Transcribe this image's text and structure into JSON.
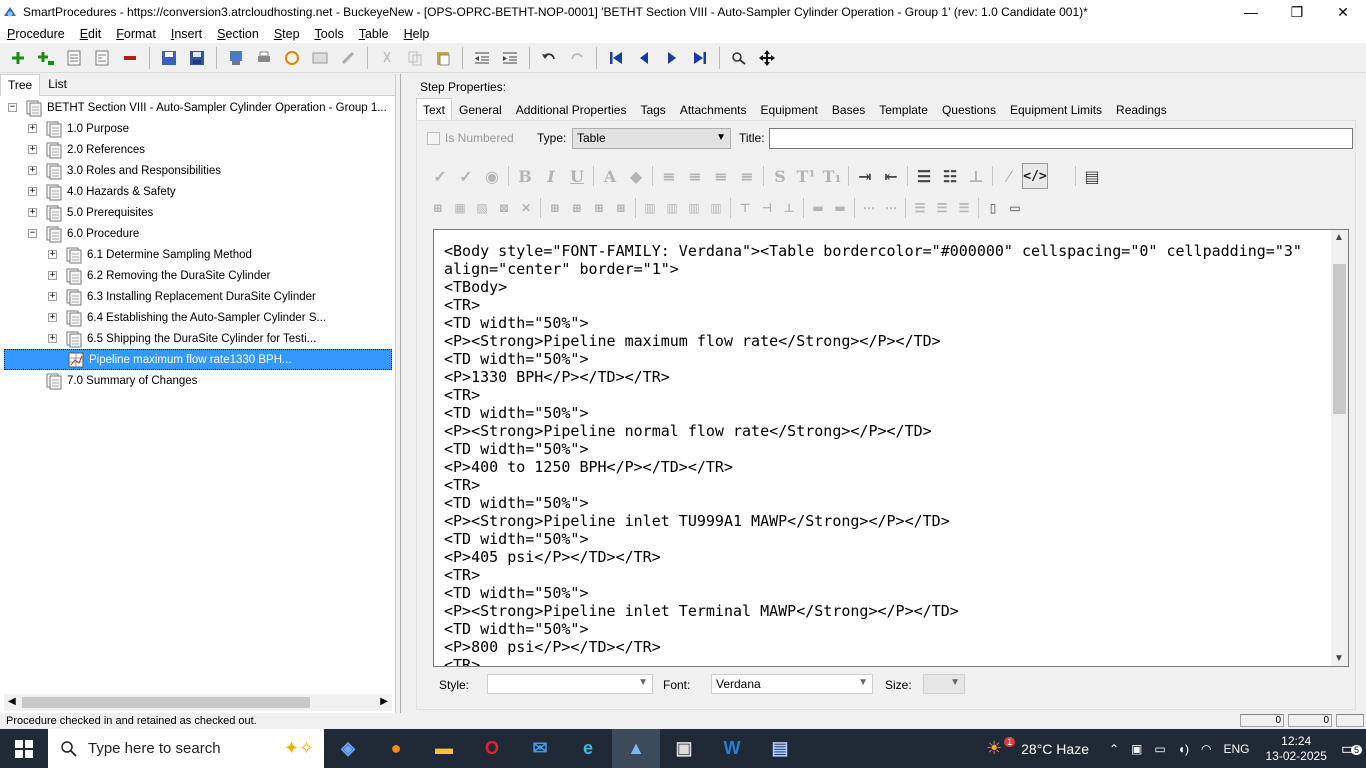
{
  "window": {
    "title": "SmartProcedures - https://conversion3.atrcloudhosting.net - BuckeyeNew - [OPS-OPRC-BETHT-NOP-0001] 'BETHT Section VIII - Auto-Sampler Cylinder Operation - Group 1' (rev: 1.0 Candidate 001)*"
  },
  "menu": [
    "Procedure",
    "Edit",
    "Format",
    "Insert",
    "Section",
    "Step",
    "Tools",
    "Table",
    "Help"
  ],
  "left_tabs": [
    "Tree",
    "List"
  ],
  "tree": {
    "root": "BETHT Section VIII - Auto-Sampler Cylinder Operation - Group 1...",
    "items": [
      {
        "label": "1.0 Purpose",
        "expander": "+"
      },
      {
        "label": "2.0 References",
        "expander": "+"
      },
      {
        "label": "3.0 Roles and Responsibilities",
        "expander": "+"
      },
      {
        "label": "4.0 Hazards & Safety",
        "expander": "+"
      },
      {
        "label": "5.0 Prerequisites",
        "expander": "+"
      },
      {
        "label": "6.0 Procedure",
        "expander": "−"
      },
      {
        "label": "6.1 Determine Sampling Method",
        "expander": "+"
      },
      {
        "label": "6.2 Removing the DuraSite Cylinder",
        "expander": "+"
      },
      {
        "label": "6.3 Installing Replacement DuraSite Cylinder",
        "expander": "+"
      },
      {
        "label": "6.4 Establishing the Auto-Sampler Cylinder S...",
        "expander": "+"
      },
      {
        "label": "6.5 Shipping the DuraSite Cylinder for Testi...",
        "expander": "+"
      },
      {
        "label": "Pipeline maximum flow rate1330 BPH...",
        "expander": ""
      },
      {
        "label": "7.0 Summary of Changes",
        "expander": ""
      }
    ]
  },
  "status": {
    "message": "Procedure checked in and retained as checked out.",
    "cell1": "0",
    "cell2": "0"
  },
  "step_props": {
    "label": "Step Properties:",
    "tabs": [
      "Text",
      "General",
      "Additional Properties",
      "Tags",
      "Attachments",
      "Equipment",
      "Bases",
      "Template",
      "Questions",
      "Equipment Limits",
      "Readings"
    ],
    "is_numbered_label": "Is Numbered",
    "type_label": "Type:",
    "type_value": "Table",
    "title_label": "Title:",
    "title_value": "",
    "code": "<Body style=\"FONT-FAMILY: Verdana\"><Table bordercolor=\"#000000\" cellspacing=\"0\" cellpadding=\"3\" align=\"center\" border=\"1\">\n<TBody>\n<TR>\n<TD width=\"50%\">\n<P><Strong>Pipeline maximum flow rate</Strong></P></TD>\n<TD width=\"50%\">\n<P>1330 BPH</P></TD></TR>\n<TR>\n<TD width=\"50%\">\n<P><Strong>Pipeline normal flow rate</Strong></P></TD>\n<TD width=\"50%\">\n<P>400 to 1250 BPH</P></TD></TR>\n<TR>\n<TD width=\"50%\">\n<P><Strong>Pipeline inlet TU999A1 MAWP</Strong></P></TD>\n<TD width=\"50%\">\n<P>405 psi</P></TD></TR>\n<TR>\n<TD width=\"50%\">\n<P><Strong>Pipeline inlet Terminal MAWP</Strong></P></TD>\n<TD width=\"50%\">\n<P>800 psi</P></TD></TR>\n<TR>",
    "style_label": "Style:",
    "style_value": "",
    "font_label": "Font:",
    "font_value": "Verdana",
    "size_label": "Size:",
    "size_value": ""
  },
  "taskbar": {
    "search_placeholder": "Type here to search",
    "weather": "28°C  Haze",
    "weather_badge": "1",
    "lang": "ENG",
    "time": "12:24",
    "date": "13-02-2025",
    "notifications": "5"
  }
}
